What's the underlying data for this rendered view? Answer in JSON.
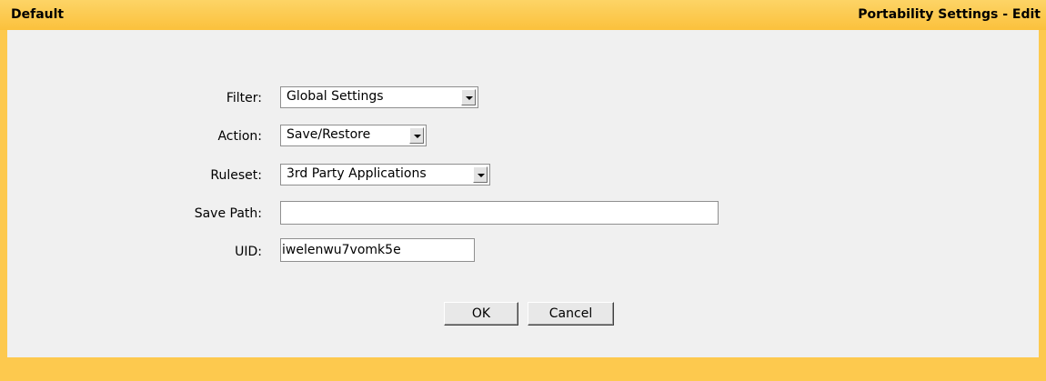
{
  "header": {
    "left_title": "Default",
    "right_title": "Portability Settings - Edit"
  },
  "form": {
    "filter": {
      "label": "Filter:",
      "value": "Global Settings"
    },
    "action": {
      "label": "Action:",
      "value": "Save/Restore"
    },
    "ruleset": {
      "label": "Ruleset:",
      "value": "3rd Party Applications"
    },
    "save_path": {
      "label": "Save Path:",
      "value": ""
    },
    "uid": {
      "label": "UID:",
      "value": "iwelenwu7vomk5e"
    }
  },
  "buttons": {
    "ok": "OK",
    "cancel": "Cancel"
  }
}
